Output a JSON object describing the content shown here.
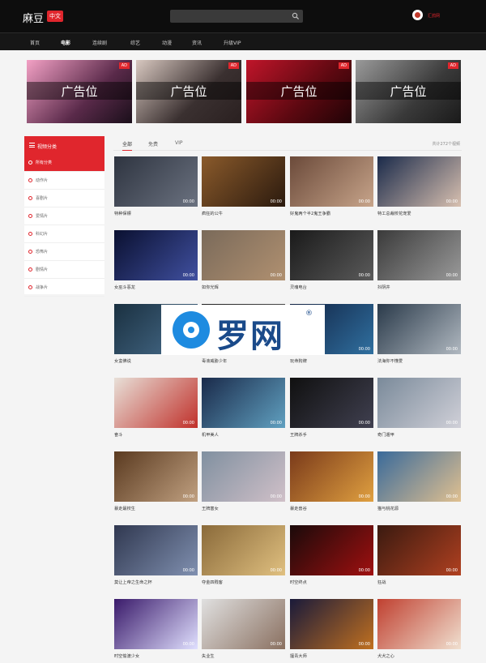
{
  "header": {
    "logo_text": "麻豆",
    "logo_badge": "中文",
    "search_placeholder": "",
    "user_label": "汇鸽网"
  },
  "nav": {
    "items": [
      "首页",
      "电影",
      "连续剧",
      "综艺",
      "动漫",
      "资讯",
      "升级VIP"
    ],
    "active_index": 1
  },
  "ads": [
    {
      "label": "广告位",
      "badge": "AD"
    },
    {
      "label": "广告位",
      "badge": "AD"
    },
    {
      "label": "广告位",
      "badge": "AD"
    },
    {
      "label": "广告位",
      "badge": "AD"
    }
  ],
  "sidebar": {
    "heading": "视频分类",
    "items": [
      "所有分类",
      "动作片",
      "喜剧片",
      "爱情片",
      "科幻片",
      "恐怖片",
      "剧情片",
      "战争片"
    ],
    "active_index": 0
  },
  "tabs": {
    "items": [
      "全部",
      "免费",
      "VIP"
    ],
    "active_index": 0,
    "count_text": "共计272个视频"
  },
  "videos": [
    {
      "title": "特种保镖",
      "duration": "00:00"
    },
    {
      "title": "疯狂的公牛",
      "duration": "00:00"
    },
    {
      "title": "好鬼两个半2鬼王争霸",
      "duration": "00:00"
    },
    {
      "title": "特工总裁校花宠爱",
      "duration": "00:00"
    },
    {
      "title": "女巫斗恶龙",
      "duration": "00:00"
    },
    {
      "title": "如你光辉",
      "duration": "00:00"
    },
    {
      "title": "灵魂电台",
      "duration": "00:00"
    },
    {
      "title": "抖阴井",
      "duration": "00:00"
    },
    {
      "title": "女蛮佛说",
      "duration": "00:00"
    },
    {
      "title": "毒液威胁少年",
      "duration": "00:00"
    },
    {
      "title": "玩命狗牌",
      "duration": "00:00"
    },
    {
      "title": "法海你不懂爱",
      "duration": "00:00"
    },
    {
      "title": "奋斗",
      "duration": "00:00"
    },
    {
      "title": "机甲美人",
      "duration": "00:00"
    },
    {
      "title": "王牌杀手",
      "duration": "00:00"
    },
    {
      "title": "奇门遁甲",
      "duration": "00:00"
    },
    {
      "title": "暴走最校生",
      "duration": "00:00"
    },
    {
      "title": "王牌害女",
      "duration": "00:00"
    },
    {
      "title": "暴走兽谷",
      "duration": "00:00"
    },
    {
      "title": "猫与桃花源",
      "duration": "00:00"
    },
    {
      "title": "莫让上帝之生命之杯",
      "duration": "00:00"
    },
    {
      "title": "夺金四贱客",
      "duration": "00:00"
    },
    {
      "title": "时空终点",
      "duration": "00:00"
    },
    {
      "title": "狂战",
      "duration": "00:00"
    },
    {
      "title": "时空偷渡少女",
      "duration": "00:00"
    },
    {
      "title": "失业生",
      "duration": "00:00"
    },
    {
      "title": "擅青大师",
      "duration": "00:00"
    },
    {
      "title": "犬犬之心",
      "duration": "00:00"
    }
  ],
  "watermark": {
    "text": "罗网",
    "reg": "®"
  },
  "colors": {
    "accent": "#e0262d",
    "header_bg": "#0d0d0d",
    "nav_bg": "#161616",
    "page_bg": "#f4f4f4"
  },
  "icons": [
    "search-icon",
    "avatar",
    "list-icon",
    "circle-icon",
    "ad-badge"
  ]
}
